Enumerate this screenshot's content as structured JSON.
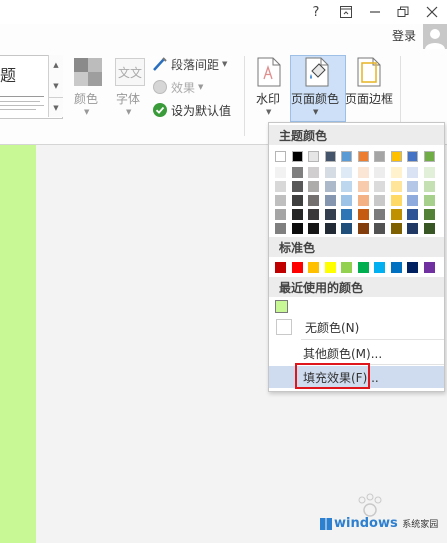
{
  "window": {
    "help_label": "?",
    "signin_label": "登录"
  },
  "ribbon": {
    "style_gallery": {
      "title": "题"
    },
    "colors_label": "颜色",
    "fonts_label": "字体",
    "fonts_icon_text": "文文",
    "paragraph_spacing_label": "段落间距",
    "effects_label": "效果",
    "set_default_label": "设为默认值",
    "watermark_label": "水印",
    "page_color_label": "页面颜色",
    "page_borders_label": "页面边框"
  },
  "dropdown": {
    "theme_colors_header": "主题颜色",
    "standard_colors_header": "标准色",
    "recent_colors_header": "最近使用的颜色",
    "no_color_label": "无颜色(N)",
    "more_colors_label": "其他颜色(M)...",
    "fill_effects_label": "填充效果(F)...",
    "theme_colors": [
      [
        "#ffffff",
        "#f2f2f2",
        "#d8d8d8",
        "#bfbfbf",
        "#a5a5a5",
        "#7f7f7f"
      ],
      [
        "#000000",
        "#7f7f7f",
        "#595959",
        "#3f3f3f",
        "#262626",
        "#0c0c0c"
      ],
      [
        "#e7e6e6",
        "#d0cece",
        "#aeabab",
        "#757070",
        "#3a3838",
        "#171616"
      ],
      [
        "#44546a",
        "#d6dce4",
        "#acb9ca",
        "#8496b0",
        "#333f4f",
        "#222a35"
      ],
      [
        "#5b9bd5",
        "#deebf6",
        "#bdd7ee",
        "#9dc3e6",
        "#2e75b5",
        "#1e4e79"
      ],
      [
        "#ed7d31",
        "#fbe5d5",
        "#f7cbac",
        "#f4b183",
        "#c55a11",
        "#833c0b"
      ],
      [
        "#a5a5a5",
        "#ededed",
        "#dbdbdb",
        "#c9c9c9",
        "#7b7b7b",
        "#525252"
      ],
      [
        "#ffc000",
        "#fff2cc",
        "#fee599",
        "#ffd965",
        "#bf9000",
        "#7f6000"
      ],
      [
        "#4472c4",
        "#dae3f3",
        "#b4c7e7",
        "#8faadc",
        "#2f5496",
        "#1f3864"
      ],
      [
        "#70ad47",
        "#e2efd9",
        "#c5e0b3",
        "#a8d08d",
        "#538135",
        "#375623"
      ]
    ],
    "standard_colors": [
      "#c00000",
      "#ff0000",
      "#ffc000",
      "#ffff00",
      "#92d050",
      "#00b050",
      "#00b0f0",
      "#0070c0",
      "#002060",
      "#7030a0"
    ],
    "recent_colors": [
      "#c7f895"
    ]
  },
  "watermark_site": {
    "text": "windows",
    "sub": "系统家园"
  },
  "colors": {
    "page_color": "#c7f895",
    "highlight": "#e0161d",
    "selected_button": "#cde0f7"
  }
}
